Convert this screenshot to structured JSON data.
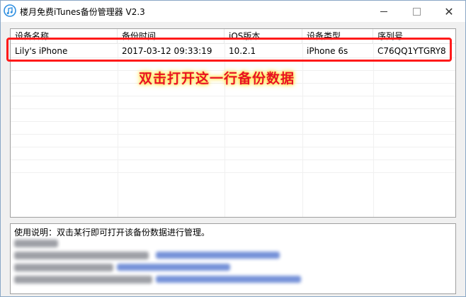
{
  "window": {
    "title": "楼月免费iTunes备份管理器 V2.3",
    "icon": "itunes-note-icon",
    "close_glyph": "✕"
  },
  "list": {
    "columns": [
      "设备名称",
      "备份时间",
      "iOS版本",
      "设备类型",
      "序列号"
    ],
    "rows": [
      {
        "device_name": "Lily's iPhone",
        "backup_time": "2017-03-12 09:33:19",
        "ios_version": "10.2.1",
        "device_type": "iPhone 6s",
        "serial": "C76QQ1YTGRY8"
      }
    ]
  },
  "annotation": {
    "text": "双击打开这一行备份数据",
    "highlight_color": "#ff1a1a",
    "text_color": "#e81123",
    "glow_color": "#ffe24d"
  },
  "info": {
    "usage_text": "使用说明：双击某行即可打开该备份数据进行管理。"
  }
}
